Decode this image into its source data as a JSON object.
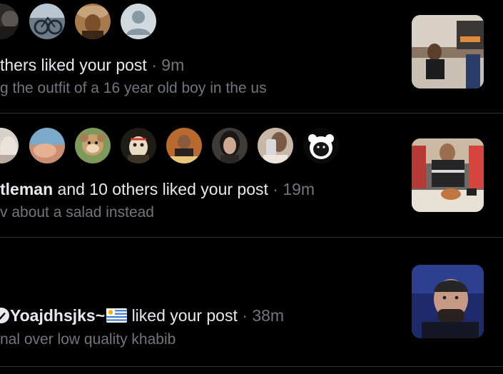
{
  "notifications": [
    {
      "actor_name": "",
      "text": "thers liked your post",
      "separator": "·",
      "time": "9m",
      "snippet": "g the outfit of a 16 year old boy in the us",
      "avatars": [
        "avatar-photo",
        "avatar-photo",
        "avatar-photo",
        "default-avatar"
      ],
      "thumbnail": "post-image"
    },
    {
      "actor_name": "tleman",
      "text": "and 10 others liked your post",
      "separator": "·",
      "time": "19m",
      "snippet": "v about a salad instead",
      "avatars": [
        "avatar-photo",
        "avatar-photo",
        "avatar-photo",
        "avatar-photo",
        "avatar-photo",
        "avatar-photo",
        "avatar-photo",
        "avatar-photo",
        "bear-avatar"
      ],
      "thumbnail": "post-image"
    },
    {
      "actor_name": "Yoajdhsjks~",
      "actor_flag": "uruguay-flag-icon",
      "actor_badge": "verified-badge-icon",
      "text": "liked your post",
      "separator": "·",
      "time": "38m",
      "snippet": "nal over low quality khabib",
      "thumbnail": "post-image"
    }
  ],
  "colors": {
    "background": "#000000",
    "primary_text": "#e7e9ea",
    "secondary_text": "#71767b",
    "divider": "#2f3336"
  }
}
